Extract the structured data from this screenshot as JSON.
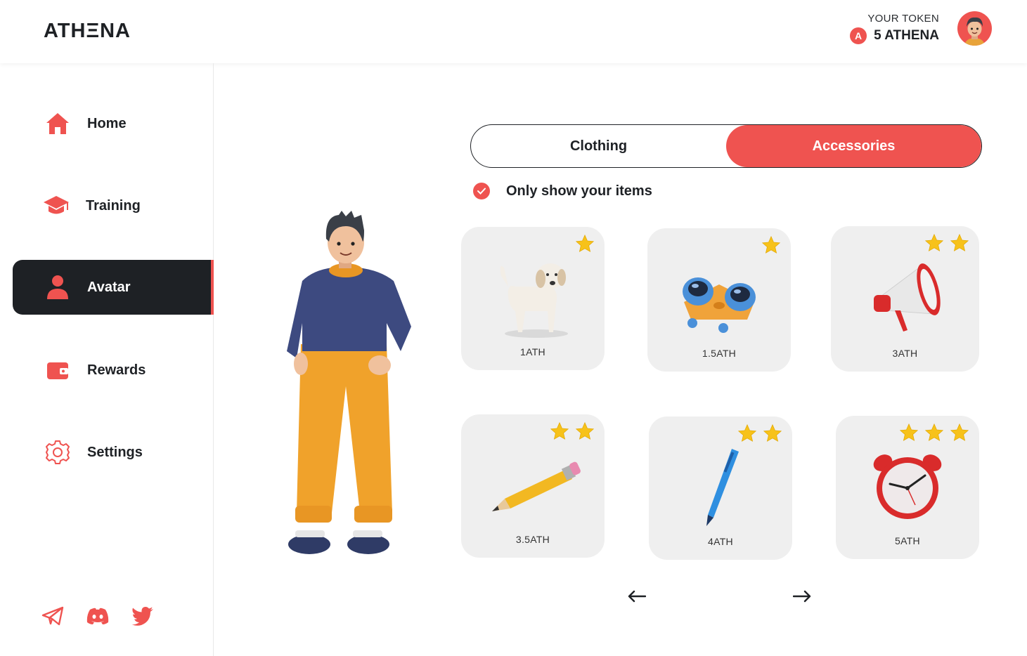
{
  "header": {
    "logo": "ATHΞNA",
    "token_label": "YOUR TOKEN",
    "token_coin": "A",
    "token_value": "5 ATHENA"
  },
  "sidebar": {
    "items": [
      {
        "label": "Home",
        "icon": "home-icon",
        "active": false
      },
      {
        "label": "Training",
        "icon": "graduation-cap-icon",
        "active": false
      },
      {
        "label": "Avatar",
        "icon": "user-icon",
        "active": true
      },
      {
        "label": "Rewards",
        "icon": "wallet-icon",
        "active": false
      },
      {
        "label": "Settings",
        "icon": "gear-icon",
        "active": false
      }
    ],
    "socials": [
      "telegram-icon",
      "discord-icon",
      "twitter-icon"
    ]
  },
  "tabs": {
    "items": [
      {
        "label": "Clothing",
        "active": false
      },
      {
        "label": "Accessories",
        "active": true
      }
    ]
  },
  "filter": {
    "label": "Only show your items",
    "checked": true
  },
  "items": [
    {
      "name": "dog",
      "price": "1ATH",
      "stars": 1
    },
    {
      "name": "binoculars",
      "price": "1.5ATH",
      "stars": 1
    },
    {
      "name": "megaphone",
      "price": "3ATH",
      "stars": 2
    },
    {
      "name": "pencil",
      "price": "3.5ATH",
      "stars": 2
    },
    {
      "name": "pen",
      "price": "4ATH",
      "stars": 2
    },
    {
      "name": "alarm-clock",
      "price": "5ATH",
      "stars": 3
    }
  ],
  "pagination": {
    "prev_icon": "arrow-left-icon",
    "next_icon": "arrow-right-icon"
  },
  "colors": {
    "accent": "#ef5350",
    "dark": "#1e2125",
    "card": "#efefef",
    "star": "#f7c21a"
  }
}
